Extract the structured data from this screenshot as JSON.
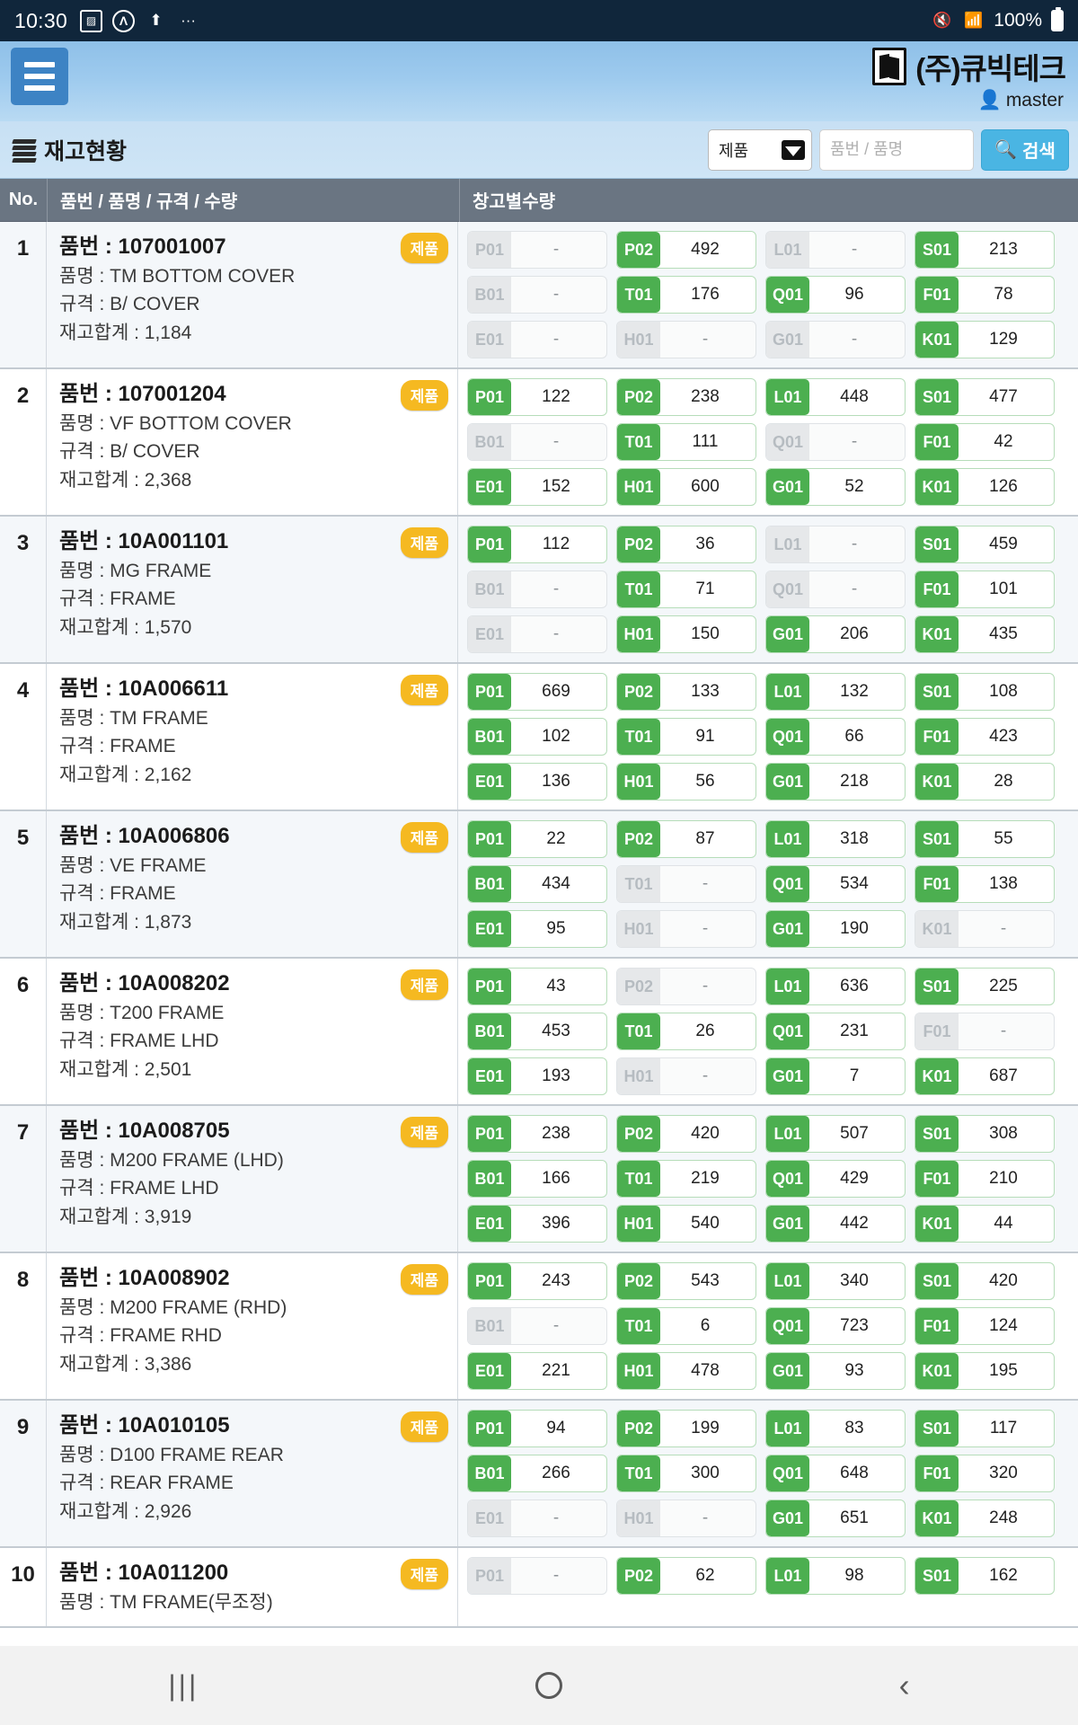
{
  "statusbar": {
    "clock": "10:30",
    "icons_left": [
      "image-icon",
      "app-circle-icon",
      "upload-icon",
      "more-icon"
    ],
    "mute_icon": "mute-icon",
    "wifi_icon": "wifi-icon",
    "battery_text": "100%",
    "battery_icon": "battery-full-icon"
  },
  "header": {
    "menu_icon": "hamburger-menu-icon",
    "logo_icon": "cubictech-logo-icon",
    "brand": "(주)큐빅테크",
    "user_icon": "user-icon",
    "user": "master"
  },
  "search": {
    "title_icon": "stack-layers-icon",
    "title": "재고현황",
    "category_value": "제품",
    "category_options": [
      "제품"
    ],
    "caret_icon": "chevron-down-icon",
    "placeholder": "품번 / 품명",
    "input_value": "",
    "search_icon": "search-icon",
    "search_label": "검색"
  },
  "table": {
    "headers": {
      "no": "No.",
      "item": "품번 / 품명 / 규격 / 수량",
      "warehouse": "창고별수량"
    },
    "labels": {
      "code": "품번 :",
      "name": "품명 :",
      "spec": "규격 :",
      "total": "재고합계 :"
    },
    "badge": "제품",
    "rows": [
      {
        "no": "1",
        "code": "107001007",
        "name": "TM BOTTOM COVER",
        "spec": "B/ COVER",
        "total": "1,184",
        "cells": [
          {
            "wh": "P01",
            "qty": "-"
          },
          {
            "wh": "P02",
            "qty": "492"
          },
          {
            "wh": "L01",
            "qty": "-"
          },
          {
            "wh": "S01",
            "qty": "213"
          },
          {
            "wh": "B01",
            "qty": "-"
          },
          {
            "wh": "T01",
            "qty": "176"
          },
          {
            "wh": "Q01",
            "qty": "96"
          },
          {
            "wh": "F01",
            "qty": "78"
          },
          {
            "wh": "E01",
            "qty": "-"
          },
          {
            "wh": "H01",
            "qty": "-"
          },
          {
            "wh": "G01",
            "qty": "-"
          },
          {
            "wh": "K01",
            "qty": "129"
          }
        ]
      },
      {
        "no": "2",
        "code": "107001204",
        "name": "VF BOTTOM COVER",
        "spec": "B/ COVER",
        "total": "2,368",
        "cells": [
          {
            "wh": "P01",
            "qty": "122"
          },
          {
            "wh": "P02",
            "qty": "238"
          },
          {
            "wh": "L01",
            "qty": "448"
          },
          {
            "wh": "S01",
            "qty": "477"
          },
          {
            "wh": "B01",
            "qty": "-"
          },
          {
            "wh": "T01",
            "qty": "111"
          },
          {
            "wh": "Q01",
            "qty": "-"
          },
          {
            "wh": "F01",
            "qty": "42"
          },
          {
            "wh": "E01",
            "qty": "152"
          },
          {
            "wh": "H01",
            "qty": "600"
          },
          {
            "wh": "G01",
            "qty": "52"
          },
          {
            "wh": "K01",
            "qty": "126"
          }
        ]
      },
      {
        "no": "3",
        "code": "10A001101",
        "name": "MG FRAME",
        "spec": "FRAME",
        "total": "1,570",
        "cells": [
          {
            "wh": "P01",
            "qty": "112"
          },
          {
            "wh": "P02",
            "qty": "36"
          },
          {
            "wh": "L01",
            "qty": "-"
          },
          {
            "wh": "S01",
            "qty": "459"
          },
          {
            "wh": "B01",
            "qty": "-"
          },
          {
            "wh": "T01",
            "qty": "71"
          },
          {
            "wh": "Q01",
            "qty": "-"
          },
          {
            "wh": "F01",
            "qty": "101"
          },
          {
            "wh": "E01",
            "qty": "-"
          },
          {
            "wh": "H01",
            "qty": "150"
          },
          {
            "wh": "G01",
            "qty": "206"
          },
          {
            "wh": "K01",
            "qty": "435"
          }
        ]
      },
      {
        "no": "4",
        "code": "10A006611",
        "name": "TM FRAME",
        "spec": "FRAME",
        "total": "2,162",
        "cells": [
          {
            "wh": "P01",
            "qty": "669"
          },
          {
            "wh": "P02",
            "qty": "133"
          },
          {
            "wh": "L01",
            "qty": "132"
          },
          {
            "wh": "S01",
            "qty": "108"
          },
          {
            "wh": "B01",
            "qty": "102"
          },
          {
            "wh": "T01",
            "qty": "91"
          },
          {
            "wh": "Q01",
            "qty": "66"
          },
          {
            "wh": "F01",
            "qty": "423"
          },
          {
            "wh": "E01",
            "qty": "136"
          },
          {
            "wh": "H01",
            "qty": "56"
          },
          {
            "wh": "G01",
            "qty": "218"
          },
          {
            "wh": "K01",
            "qty": "28"
          }
        ]
      },
      {
        "no": "5",
        "code": "10A006806",
        "name": "VE FRAME",
        "spec": "FRAME",
        "total": "1,873",
        "cells": [
          {
            "wh": "P01",
            "qty": "22"
          },
          {
            "wh": "P02",
            "qty": "87"
          },
          {
            "wh": "L01",
            "qty": "318"
          },
          {
            "wh": "S01",
            "qty": "55"
          },
          {
            "wh": "B01",
            "qty": "434"
          },
          {
            "wh": "T01",
            "qty": "-"
          },
          {
            "wh": "Q01",
            "qty": "534"
          },
          {
            "wh": "F01",
            "qty": "138"
          },
          {
            "wh": "E01",
            "qty": "95"
          },
          {
            "wh": "H01",
            "qty": "-"
          },
          {
            "wh": "G01",
            "qty": "190"
          },
          {
            "wh": "K01",
            "qty": "-"
          }
        ]
      },
      {
        "no": "6",
        "code": "10A008202",
        "name": "T200 FRAME",
        "spec": "FRAME LHD",
        "total": "2,501",
        "cells": [
          {
            "wh": "P01",
            "qty": "43"
          },
          {
            "wh": "P02",
            "qty": "-"
          },
          {
            "wh": "L01",
            "qty": "636"
          },
          {
            "wh": "S01",
            "qty": "225"
          },
          {
            "wh": "B01",
            "qty": "453"
          },
          {
            "wh": "T01",
            "qty": "26"
          },
          {
            "wh": "Q01",
            "qty": "231"
          },
          {
            "wh": "F01",
            "qty": "-"
          },
          {
            "wh": "E01",
            "qty": "193"
          },
          {
            "wh": "H01",
            "qty": "-"
          },
          {
            "wh": "G01",
            "qty": "7"
          },
          {
            "wh": "K01",
            "qty": "687"
          }
        ]
      },
      {
        "no": "7",
        "code": "10A008705",
        "name": "M200 FRAME (LHD)",
        "spec": "FRAME LHD",
        "total": "3,919",
        "cells": [
          {
            "wh": "P01",
            "qty": "238"
          },
          {
            "wh": "P02",
            "qty": "420"
          },
          {
            "wh": "L01",
            "qty": "507"
          },
          {
            "wh": "S01",
            "qty": "308"
          },
          {
            "wh": "B01",
            "qty": "166"
          },
          {
            "wh": "T01",
            "qty": "219"
          },
          {
            "wh": "Q01",
            "qty": "429"
          },
          {
            "wh": "F01",
            "qty": "210"
          },
          {
            "wh": "E01",
            "qty": "396"
          },
          {
            "wh": "H01",
            "qty": "540"
          },
          {
            "wh": "G01",
            "qty": "442"
          },
          {
            "wh": "K01",
            "qty": "44"
          }
        ]
      },
      {
        "no": "8",
        "code": "10A008902",
        "name": "M200 FRAME (RHD)",
        "spec": "FRAME RHD",
        "total": "3,386",
        "cells": [
          {
            "wh": "P01",
            "qty": "243"
          },
          {
            "wh": "P02",
            "qty": "543"
          },
          {
            "wh": "L01",
            "qty": "340"
          },
          {
            "wh": "S01",
            "qty": "420"
          },
          {
            "wh": "B01",
            "qty": "-"
          },
          {
            "wh": "T01",
            "qty": "6"
          },
          {
            "wh": "Q01",
            "qty": "723"
          },
          {
            "wh": "F01",
            "qty": "124"
          },
          {
            "wh": "E01",
            "qty": "221"
          },
          {
            "wh": "H01",
            "qty": "478"
          },
          {
            "wh": "G01",
            "qty": "93"
          },
          {
            "wh": "K01",
            "qty": "195"
          }
        ]
      },
      {
        "no": "9",
        "code": "10A010105",
        "name": "D100 FRAME REAR",
        "spec": "REAR FRAME",
        "total": "2,926",
        "cells": [
          {
            "wh": "P01",
            "qty": "94"
          },
          {
            "wh": "P02",
            "qty": "199"
          },
          {
            "wh": "L01",
            "qty": "83"
          },
          {
            "wh": "S01",
            "qty": "117"
          },
          {
            "wh": "B01",
            "qty": "266"
          },
          {
            "wh": "T01",
            "qty": "300"
          },
          {
            "wh": "Q01",
            "qty": "648"
          },
          {
            "wh": "F01",
            "qty": "320"
          },
          {
            "wh": "E01",
            "qty": "-"
          },
          {
            "wh": "H01",
            "qty": "-"
          },
          {
            "wh": "G01",
            "qty": "651"
          },
          {
            "wh": "K01",
            "qty": "248"
          }
        ]
      },
      {
        "no": "10",
        "code": "10A011200",
        "name": "TM FRAME(무조정)",
        "spec": "",
        "total": "",
        "cells": [
          {
            "wh": "P01",
            "qty": "-"
          },
          {
            "wh": "P02",
            "qty": "62"
          },
          {
            "wh": "L01",
            "qty": "98"
          },
          {
            "wh": "S01",
            "qty": "162"
          }
        ]
      }
    ]
  },
  "navbar": {
    "recent_icon": "recent-apps-icon",
    "home_icon": "home-icon",
    "back_icon": "back-icon"
  }
}
